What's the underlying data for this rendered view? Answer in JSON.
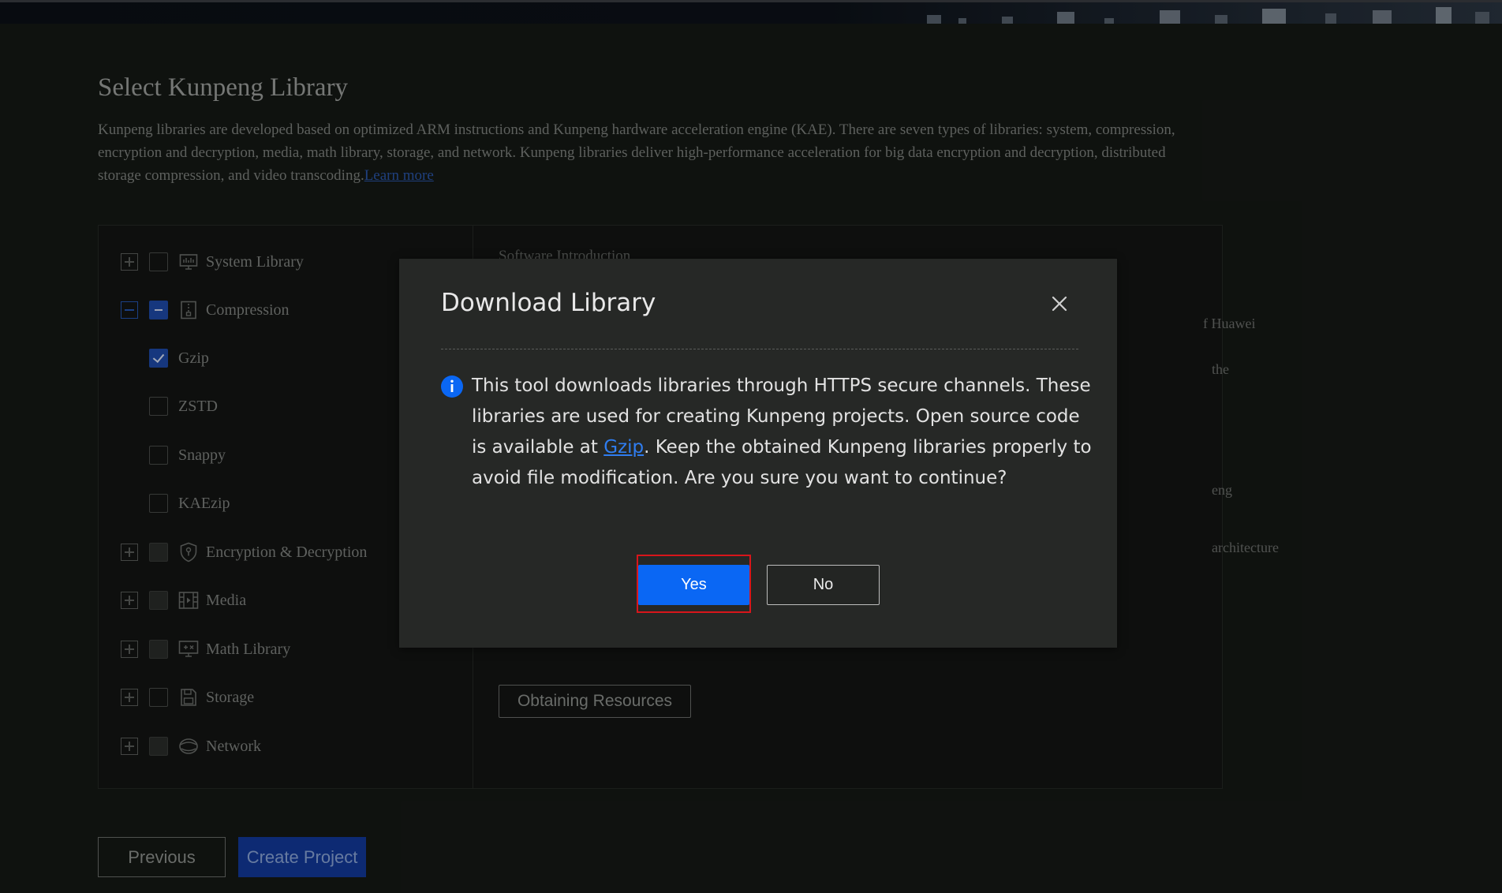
{
  "page": {
    "title": "Select Kunpeng Library",
    "description": "Kunpeng libraries are developed based on optimized ARM instructions and Kunpeng hardware acceleration engine (KAE). There are seven types of libraries: system, compression, encryption and decryption, media, math library, storage, and network. Kunpeng libraries deliver high-performance acceleration for big data encryption and decryption, distributed storage compression, and video transcoding.",
    "learn_more": "Learn more"
  },
  "tree": {
    "items": [
      {
        "label": "System Library",
        "icon": "system-library-icon",
        "expander": "plus",
        "checkbox": "unchecked"
      },
      {
        "label": "Compression",
        "icon": "compression-icon",
        "expander": "minus",
        "checkbox": "indeterminate"
      },
      {
        "label": "Gzip",
        "checkbox": "checked"
      },
      {
        "label": "ZSTD",
        "checkbox": "unchecked"
      },
      {
        "label": "Snappy",
        "checkbox": "unchecked"
      },
      {
        "label": "KAEzip",
        "checkbox": "unchecked"
      },
      {
        "label": "Encryption & Decryption",
        "icon": "shield-icon",
        "expander": "plus",
        "checkbox": "disabled"
      },
      {
        "label": "Media",
        "icon": "media-icon",
        "expander": "plus",
        "checkbox": "disabled"
      },
      {
        "label": "Math Library",
        "icon": "math-icon",
        "expander": "plus",
        "checkbox": "disabled"
      },
      {
        "label": "Storage",
        "icon": "storage-icon",
        "expander": "plus",
        "checkbox": "unchecked"
      },
      {
        "label": "Network",
        "icon": "network-icon",
        "expander": "plus",
        "checkbox": "disabled"
      }
    ]
  },
  "details": {
    "section_title": "Software Introduction",
    "peek_1": "f Huawei",
    "peek_2": "the",
    "peek_3": "eng",
    "peek_4": "architecture",
    "obtain_label": "Obtaining Resources"
  },
  "footer": {
    "previous_label": "Previous",
    "create_label": "Create Project"
  },
  "dialog": {
    "title": "Download Library",
    "msg_before": "This tool downloads libraries through HTTPS secure channels. These libraries are used for creating Kunpeng projects. Open source code is available at ",
    "link": "Gzip",
    "msg_after": ". Keep the obtained Kunpeng libraries properly to avoid file modification. Are you sure you want to continue?",
    "yes_label": "Yes",
    "no_label": "No"
  },
  "colors": {
    "primary": "#0a67f4",
    "focus_outline": "#d8161b",
    "link": "#2f7df0"
  }
}
